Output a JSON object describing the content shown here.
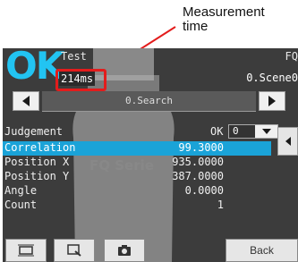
{
  "callout": {
    "line1": "Measurement",
    "line2": "time"
  },
  "screen": {
    "judgement_big": "OK",
    "title": "Test",
    "top_right": "FQ",
    "time": "214ms",
    "scene": "0.Scene0",
    "search_label": "0.Search",
    "header": {
      "label": "Judgement",
      "value": "OK",
      "dropdown_value": "0"
    },
    "rows": [
      {
        "label": "Correlation",
        "value": "99.3000"
      },
      {
        "label": "Position X",
        "value": "935.0000"
      },
      {
        "label": "Position Y",
        "value": "387.0000"
      },
      {
        "label": "Angle",
        "value": "0.0000"
      },
      {
        "label": "Count",
        "value": "1"
      }
    ],
    "back_label": "Back",
    "icons": [
      "frame-icon",
      "zoom-icon",
      "camera-icon"
    ],
    "colors": {
      "ok": "#22c4f2",
      "highlight": "#1aa3d8",
      "callout_box": "#e31c1c"
    }
  }
}
